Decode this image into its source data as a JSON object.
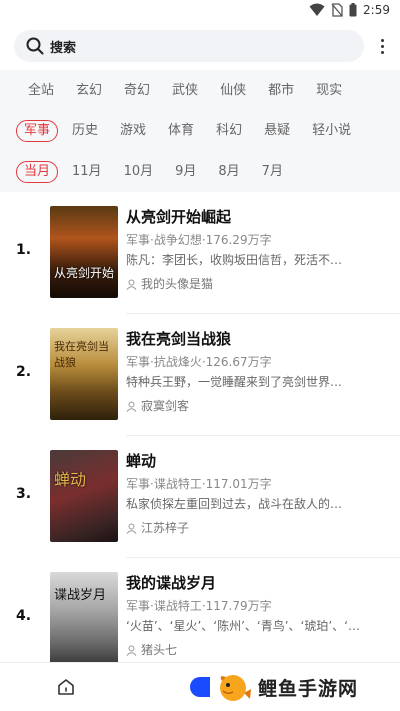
{
  "status_bar": {
    "time": "2:59",
    "icons": [
      "wifi-icon",
      "no-sim-icon",
      "battery-icon"
    ]
  },
  "search": {
    "label": "搜索"
  },
  "filters": {
    "row1": [
      "全站",
      "玄幻",
      "奇幻",
      "武侠",
      "仙侠",
      "都市",
      "现实"
    ],
    "row2": [
      "军事",
      "历史",
      "游戏",
      "体育",
      "科幻",
      "悬疑",
      "轻小说"
    ],
    "row2_selected": "军事",
    "row3": [
      "当月",
      "11月",
      "10月",
      "9月",
      "8月",
      "7月"
    ],
    "row3_selected": "当月"
  },
  "books": [
    {
      "rank": "1.",
      "title": "从亮剑开始崛起",
      "meta": "军事·战争幻想·176.29万字",
      "desc": "陈凡：李团长，收购坂田信哲，死活不…",
      "author": "我的头像是猫",
      "cover_text": "从亮剑开始"
    },
    {
      "rank": "2.",
      "title": "我在亮剑当战狼",
      "meta": "军事·抗战烽火·126.67万字",
      "desc": "特种兵王野，一觉睡醒来到了亮剑世界…",
      "author": "寂寞剑客",
      "cover_text": "我在亮剑当战狼"
    },
    {
      "rank": "3.",
      "title": "蝉动",
      "meta": "军事·谍战特工·117.01万字",
      "desc": "私家侦探左重回到过去，战斗在敌人的…",
      "author": "江苏梓子",
      "cover_text": "蝉动"
    },
    {
      "rank": "4.",
      "title": "我的谍战岁月",
      "meta": "军事·谍战特工·117.79万字",
      "desc": "‘火苗’、‘星火’、‘陈州’、‘青鸟’、‘琥珀’、‘…",
      "author": "猪头七",
      "cover_text": "谍战岁月"
    }
  ],
  "watermark": {
    "text": "鲤鱼手游网"
  },
  "colors": {
    "accent": "#e4393c",
    "filter_bg": "#f6f7f9",
    "search_bg": "#f1f3f6",
    "nav_blue": "#1a4bff"
  }
}
